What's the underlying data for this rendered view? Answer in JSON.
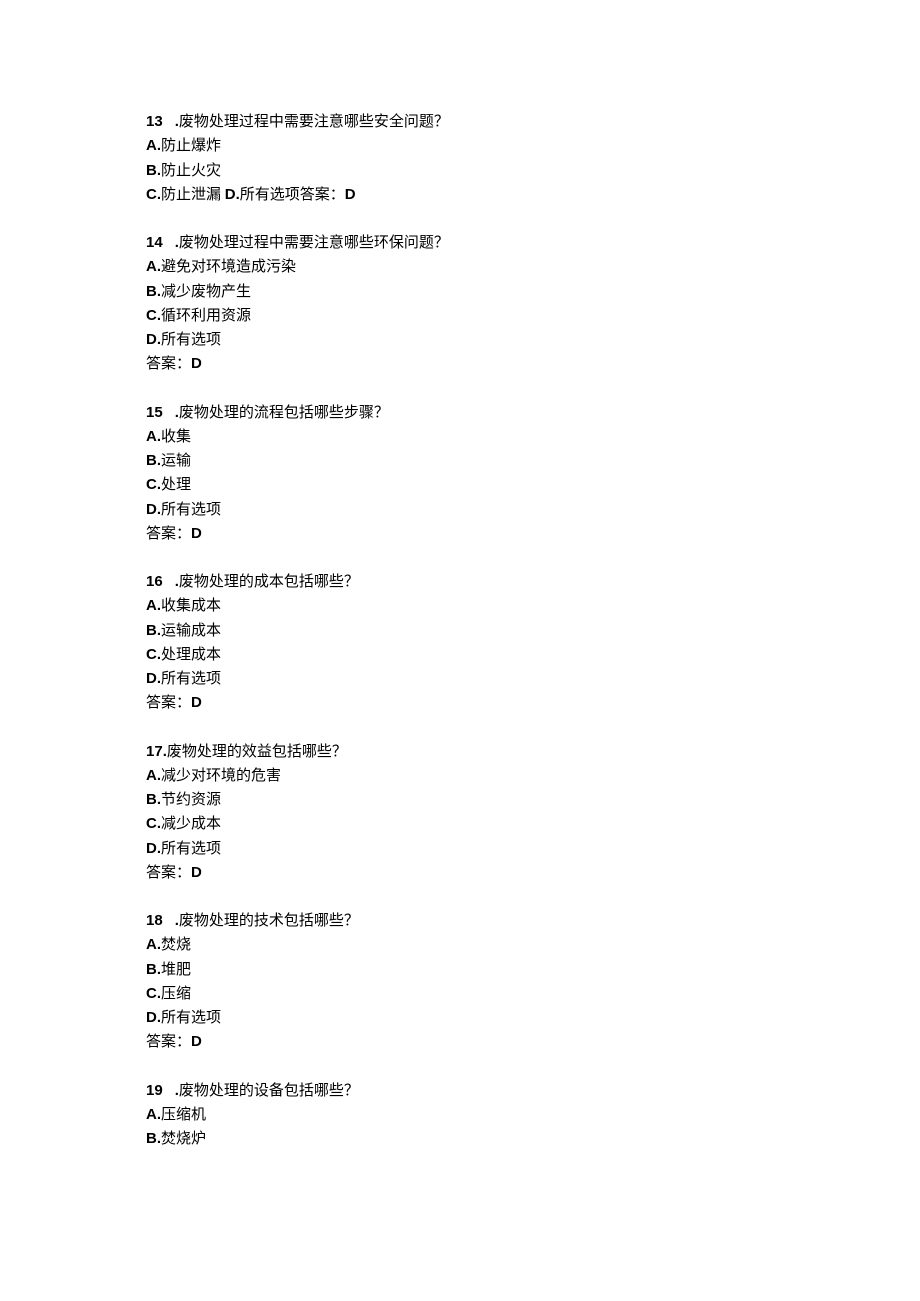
{
  "questions": [
    {
      "num": "13",
      "question": "废物处理过程中需要注意哪些安全问题？",
      "opts": {
        "A": "防止爆炸",
        "B": "防止火灾"
      },
      "cd_line": {
        "c_label": "C.",
        "c_text": "防止泄漏 ",
        "d_label": "D.",
        "d_text": "所有选项",
        "ans_prefix": "答案：",
        "ans_val": "D"
      }
    },
    {
      "num": "14",
      "question": "废物处理过程中需要注意哪些环保问题？",
      "opts": {
        "A": "避免对环境造成污染",
        "B": "减少废物产生",
        "C": "循环利用资源",
        "D": "所有选项"
      },
      "answer": {
        "prefix": "答案：",
        "val": "D"
      }
    },
    {
      "num": "15",
      "question": "废物处理的流程包括哪些步骤？",
      "opts": {
        "A": "收集",
        "B": "运输",
        "C": "处理",
        "D": "所有选项"
      },
      "answer": {
        "prefix": "答案：",
        "val": "D"
      }
    },
    {
      "num": "16",
      "question": "废物处理的成本包括哪些？",
      "opts": {
        "A": "收集成本",
        "B": "运输成本",
        "C": "处理成本",
        "D": "所有选项"
      },
      "answer": {
        "prefix": "答案：",
        "val": "D"
      }
    },
    {
      "num": "17",
      "question": "废物处理的效益包括哪些？",
      "tight": true,
      "opts": {
        "A": "减少对环境的危害",
        "B": "节约资源",
        "C": "减少成本",
        "D": "所有选项"
      },
      "answer": {
        "prefix": "答案：",
        "val": "D"
      }
    },
    {
      "num": "18",
      "question": "废物处理的技术包括哪些？",
      "opts": {
        "A": "焚烧",
        "B": "堆肥",
        "C": "压缩",
        "D": "所有选项"
      },
      "answer": {
        "prefix": "答案：",
        "val": "D"
      }
    },
    {
      "num": "19",
      "question": "废物处理的设备包括哪些？",
      "opts": {
        "A": "压缩机",
        "B": "焚烧炉"
      }
    }
  ]
}
